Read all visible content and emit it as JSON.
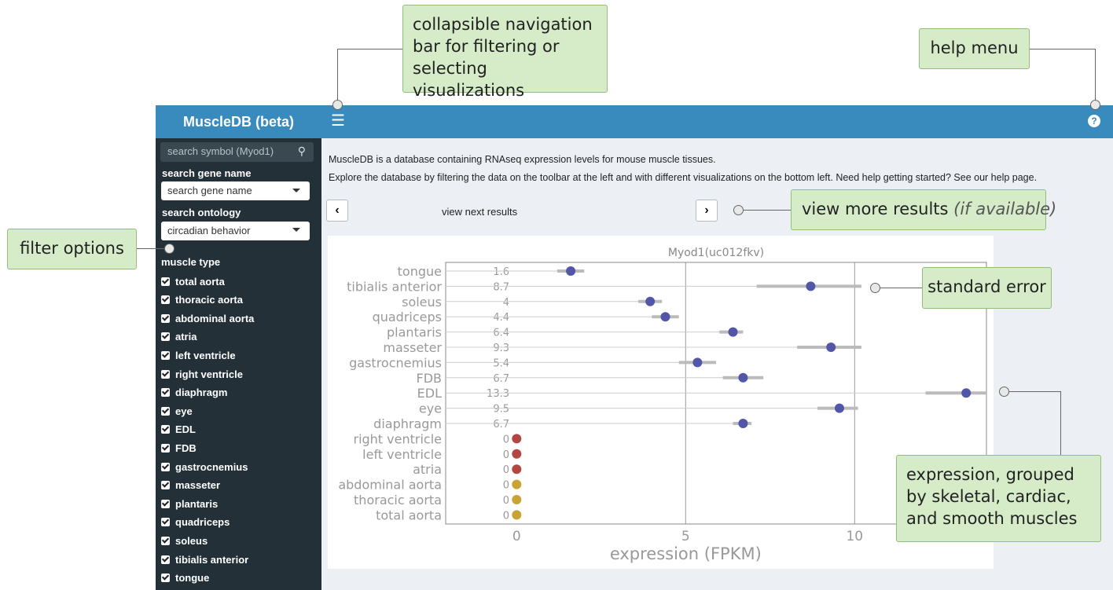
{
  "app": {
    "title": "MuscleDB (beta)"
  },
  "sidebar": {
    "search_symbol_placeholder": "search symbol (Myod1)",
    "search_gene_label": "search gene name",
    "search_gene_value": "search gene name",
    "search_ontology_label": "search ontology",
    "search_ontology_value": "circadian behavior",
    "muscle_type_label": "muscle type",
    "muscle_types": [
      {
        "label": "total aorta",
        "checked": true
      },
      {
        "label": "thoracic aorta",
        "checked": true
      },
      {
        "label": "abdominal aorta",
        "checked": true
      },
      {
        "label": "atria",
        "checked": true
      },
      {
        "label": "left ventricle",
        "checked": true
      },
      {
        "label": "right ventricle",
        "checked": true
      },
      {
        "label": "diaphragm",
        "checked": true
      },
      {
        "label": "eye",
        "checked": true
      },
      {
        "label": "EDL",
        "checked": true
      },
      {
        "label": "FDB",
        "checked": true
      },
      {
        "label": "gastrocnemius",
        "checked": true
      },
      {
        "label": "masseter",
        "checked": true
      },
      {
        "label": "plantaris",
        "checked": true
      },
      {
        "label": "quadriceps",
        "checked": true
      },
      {
        "label": "soleus",
        "checked": true
      },
      {
        "label": "tibialis anterior",
        "checked": true
      },
      {
        "label": "tongue",
        "checked": true
      }
    ]
  },
  "main": {
    "intro_line1": "MuscleDB is a database containing RNAseq expression levels for mouse muscle tissues.",
    "intro_line2": "Explore the database by filtering the data on the toolbar at the left and with different visualizations on the bottom left. Need help getting started? See our help page.",
    "prev_icon": "chevron-left",
    "next_icon": "chevron-right",
    "view_next_label": "view next results"
  },
  "annotations": {
    "nav_bar": "collapsible navigation bar for filtering or selecting visualizations",
    "help_menu": "help menu",
    "filter_options": "filter options",
    "more_results_main": "view more results",
    "more_results_note": "(if available)",
    "standard_error": "standard error",
    "expression_grouped": "expression, grouped by skeletal, cardiac, and smooth muscles"
  },
  "colors": {
    "header_blue": "#3a8bbd",
    "sidebar_dark": "#233038",
    "skeletal": "#5256a8",
    "cardiac": "#b34542",
    "smooth": "#c9a435",
    "callout_bg": "#d6ecc9"
  },
  "chart_data": {
    "type": "scatter",
    "title": "Myod1(uc012fkv)",
    "xlabel": "expression (FPKM)",
    "xticks": [
      0,
      5,
      10
    ],
    "xlim": [
      -2.1,
      13.9
    ],
    "grid": true,
    "categories": [
      "tongue",
      "tibialis anterior",
      "soleus",
      "quadriceps",
      "plantaris",
      "masseter",
      "gastrocnemius",
      "FDB",
      "EDL",
      "eye",
      "diaphragm",
      "right ventricle",
      "left ventricle",
      "atria",
      "abdominal aorta",
      "thoracic aorta",
      "total aorta"
    ],
    "value_labels": [
      "1.6",
      "8.7",
      "4",
      "4.4",
      "6.4",
      "9.3",
      "5.4",
      "6.7",
      "13.3",
      "9.5",
      "6.7",
      "0",
      "0",
      "0",
      "0",
      "0",
      "0"
    ],
    "values": [
      1.6,
      8.7,
      3.95,
      4.4,
      6.4,
      9.3,
      5.35,
      6.7,
      13.3,
      9.55,
      6.7,
      0,
      0,
      0,
      0,
      0,
      0
    ],
    "error_low": [
      1.2,
      7.1,
      3.6,
      4.0,
      6.0,
      8.3,
      4.8,
      6.1,
      12.1,
      8.9,
      6.4,
      0,
      0,
      0,
      0,
      0,
      0
    ],
    "error_high": [
      2.0,
      10.2,
      4.3,
      4.8,
      6.7,
      10.2,
      5.9,
      7.3,
      13.9,
      10.1,
      6.95,
      0,
      0,
      0,
      0,
      0,
      0
    ],
    "groups": [
      "skeletal",
      "skeletal",
      "skeletal",
      "skeletal",
      "skeletal",
      "skeletal",
      "skeletal",
      "skeletal",
      "skeletal",
      "skeletal",
      "skeletal",
      "cardiac",
      "cardiac",
      "cardiac",
      "smooth",
      "smooth",
      "smooth"
    ]
  }
}
